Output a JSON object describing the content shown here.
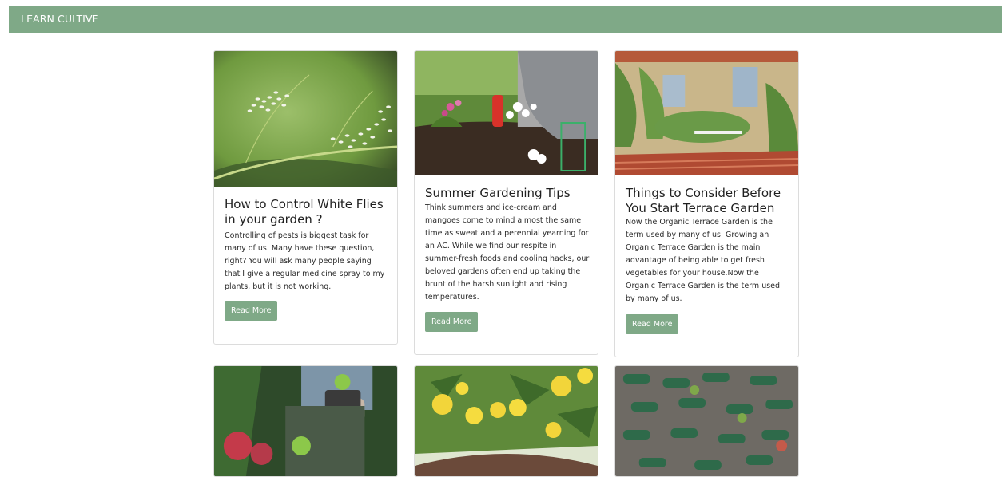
{
  "navbar": {
    "brand": "LEARN CULTIVE"
  },
  "cards": [
    {
      "title": "How to Control White Flies in your garden ?",
      "text": "Controlling of pests is biggest task for many of us. Many have these question, right? You will ask many people saying that I give a regular medicine spray to my plants, but it is not working.",
      "button": "Read More"
    },
    {
      "title": "Summer Gardening Tips",
      "text": "Think summers and ice-cream and mangoes come to mind almost the same time as sweat and a perennial yearning for an AC. While we find our respite in summer-fresh foods and cooling hacks, our beloved gardens often end up taking the brunt of the harsh sunlight and rising temperatures.",
      "button": "Read More"
    },
    {
      "title": "Things to Consider Before You Start Terrace Garden",
      "text": "Now the Organic Terrace Garden is the term used by many of us. Growing an Organic Terrace Garden is the main advantage of being able to get fresh vegetables for your house.Now the Organic Terrace Garden is the term used by many of us.",
      "button": "Read More"
    }
  ],
  "colors": {
    "brand": "#7fa987",
    "card_border": "#dcdcdc"
  }
}
